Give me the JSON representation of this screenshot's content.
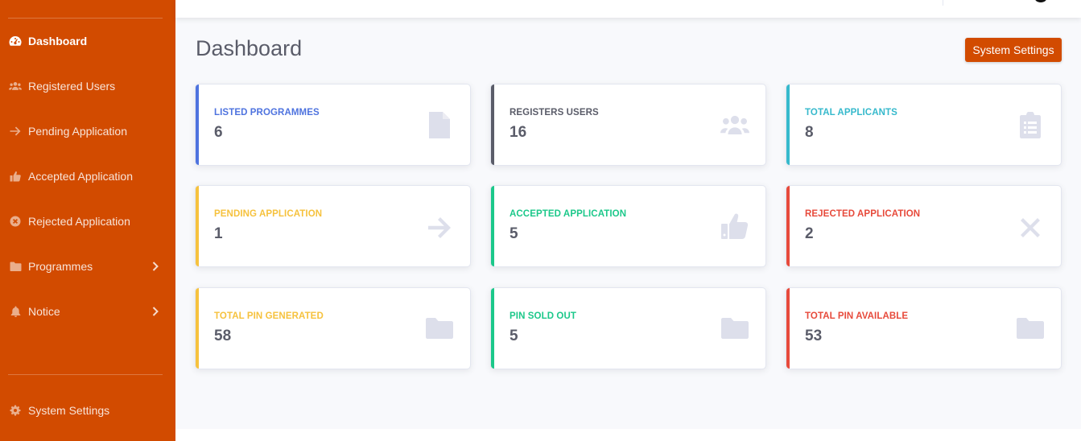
{
  "sidebar": {
    "items": [
      {
        "label": "Dashboard",
        "icon": "tachometer-icon"
      },
      {
        "label": "Registered Users",
        "icon": "users-icon"
      },
      {
        "label": "Pending Application",
        "icon": "arrow-right-icon"
      },
      {
        "label": "Accepted Application",
        "icon": "thumbs-up-icon"
      },
      {
        "label": "Rejected Application",
        "icon": "times-circle-icon"
      },
      {
        "label": "Programmes",
        "icon": "folder-icon"
      },
      {
        "label": "Notice",
        "icon": "bell-icon"
      }
    ],
    "settings_label": "System Settings"
  },
  "main": {
    "title": "Dashboard",
    "settings_button": "System Settings"
  },
  "cards": [
    {
      "label": "LISTED PROGRAMMES",
      "value": "6",
      "color": "#4e73df",
      "icon": "file-icon"
    },
    {
      "label": "REGISTERS USERS",
      "value": "16",
      "color": "#5a5c69",
      "icon": "users-icon"
    },
    {
      "label": "TOTAL APPLICANTS",
      "value": "8",
      "color": "#36b9cc",
      "icon": "clipboard-list-icon"
    },
    {
      "label": "PENDING APPLICATION",
      "value": "1",
      "color": "#f6c23e",
      "icon": "arrow-right-icon"
    },
    {
      "label": "ACCEPTED APPLICATION",
      "value": "5",
      "color": "#1cc88a",
      "icon": "thumbs-up-icon"
    },
    {
      "label": "REJECTED APPLICATION",
      "value": "2",
      "color": "#e74a3b",
      "icon": "times-icon"
    },
    {
      "label": "TOTAL PIN GENERATED",
      "value": "58",
      "color": "#f6c23e",
      "icon": "folder-icon"
    },
    {
      "label": "PIN SOLD OUT",
      "value": "5",
      "color": "#1cc88a",
      "icon": "folder-icon"
    },
    {
      "label": "TOTAL PIN AVAILABLE",
      "value": "53",
      "color": "#e74a3b",
      "icon": "folder-icon"
    }
  ],
  "colors": {
    "brand": "#d24b00",
    "primary": "#4e73df",
    "dark": "#5a5c69",
    "info": "#36b9cc",
    "warning": "#f6c23e",
    "success": "#1cc88a",
    "danger": "#e74a3b"
  }
}
